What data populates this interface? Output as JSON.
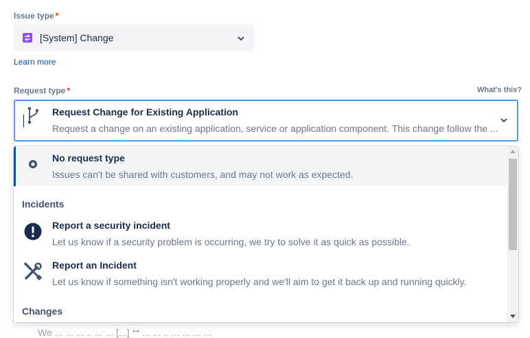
{
  "issue_type": {
    "label": "Issue type",
    "required_mark": "*",
    "value": "[System] Change",
    "icon": "change-type-icon",
    "icon_color": "#904ee2",
    "learn_more": "Learn more"
  },
  "request_type": {
    "label": "Request type",
    "required_mark": "*",
    "whats_this": "What's this?",
    "selected_title": "Request Change for Existing Application",
    "selected_description": "Request a change on an existing application, service or application component. This change follow the ...",
    "icon": "branch-icon",
    "focus_color": "#4c9aff"
  },
  "menu": {
    "options_top": [
      {
        "title": "No request type",
        "description": "Issues can't be shared with customers, and may not work as expected.",
        "icon": "no-request-type-icon"
      }
    ],
    "groups": [
      {
        "heading": "Incidents",
        "options": [
          {
            "title": "Report a security incident",
            "description": "Let us know if a security problem is occurring, we try to solve it as quick as possible.",
            "icon": "exclamation-icon"
          },
          {
            "title": "Report an Incident",
            "description": "Let us know if something isn't working properly and we'll aim to get it back up and running quickly.",
            "icon": "tools-icon"
          }
        ]
      },
      {
        "heading": "Changes"
      }
    ],
    "selected_accent": "#0052cc"
  },
  "behind_fragment": "We ... ... ...  .. ...  ...  [...]  ** ... ... ..  ...  ... ... ..."
}
